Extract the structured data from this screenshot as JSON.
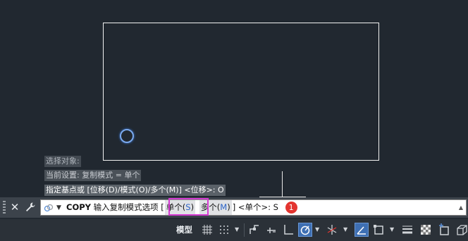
{
  "history": [
    "选择对象:",
    "当前设置:  复制模式 = 单个",
    "指定基点或 [位移(D)/模式(O)/多个(M)] <位移>: O"
  ],
  "command_line": {
    "command": "COPY",
    "prompt": "输入复制模式选项",
    "bracket_open": "[",
    "option_single": "单个(S)",
    "option_single_name": "单个(",
    "option_single_key": "S",
    "option_single_close": ")",
    "option_multiple_name": "多个(",
    "option_multiple_key": "M",
    "option_multiple_close": ")",
    "bracket_close": "]",
    "default": "<单个>:",
    "typed_value": "S",
    "step_badge": "1"
  },
  "status_bar": {
    "model_label": "模型"
  },
  "colors": {
    "canvas_bg": "#212830",
    "highlight": "#d63ad3",
    "badge": "#e3342f",
    "active_toggle": "#3e6fb3"
  }
}
